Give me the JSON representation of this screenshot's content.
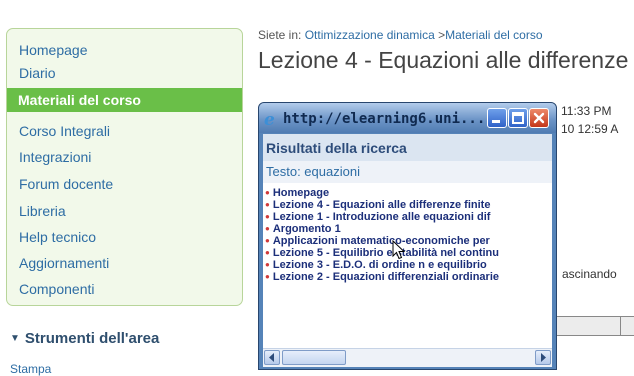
{
  "sidebar": {
    "items": [
      {
        "label": "Homepage"
      },
      {
        "label": "Diario"
      },
      {
        "label": "Materiali del corso"
      },
      {
        "label": "Corso Integrali"
      },
      {
        "label": "Integrazioni"
      },
      {
        "label": "Forum docente"
      },
      {
        "label": "Libreria"
      },
      {
        "label": "Help tecnico"
      },
      {
        "label": "Aggiornamenti"
      },
      {
        "label": "Componenti"
      }
    ],
    "active_index": 2,
    "tools_header": "Strumenti dell'area",
    "tools_first": "Stampa"
  },
  "main": {
    "breadcrumb_prefix": "Siete in:",
    "breadcrumb_link1": "Ottimizzazione dinamica",
    "breadcrumb_sep": ">",
    "breadcrumb_link2": "Materiali del corso",
    "title": "Lezione 4 - Equazioni alle differenze",
    "bg_text_time1": "11:33 PM",
    "bg_text_time2": "10 12:59 A",
    "bg_text_word": "ascinando"
  },
  "popup": {
    "title": "http://elearning6.uni...",
    "results_title": "Risultati della ricerca",
    "query": "Testo: equazioni",
    "results": [
      "Homepage",
      "Lezione 4 - Equazioni alle differenze finite",
      "Lezione 1 - Introduzione alle equazioni dif",
      "Argomento 1",
      "Applicazioni matematico-economiche per",
      "Lezione 5 - Equilibrio e stabilità nel continu",
      "Lezione 3 - E.D.O. di ordine n e equilibrio",
      "Lezione 2 - Equazioni differenziali ordinarie"
    ]
  },
  "icons": {
    "browser": "ie-icon",
    "minimize": "minimize-icon",
    "maximize": "maximize-icon",
    "close": "close-icon",
    "cursor": "mouse-cursor-icon"
  },
  "colors": {
    "active_menu": "#6abf48",
    "link": "#2e6da4",
    "popup_frame": "#5583b8",
    "result_text": "#1c2f7a",
    "bullet": "#d03a3a"
  }
}
